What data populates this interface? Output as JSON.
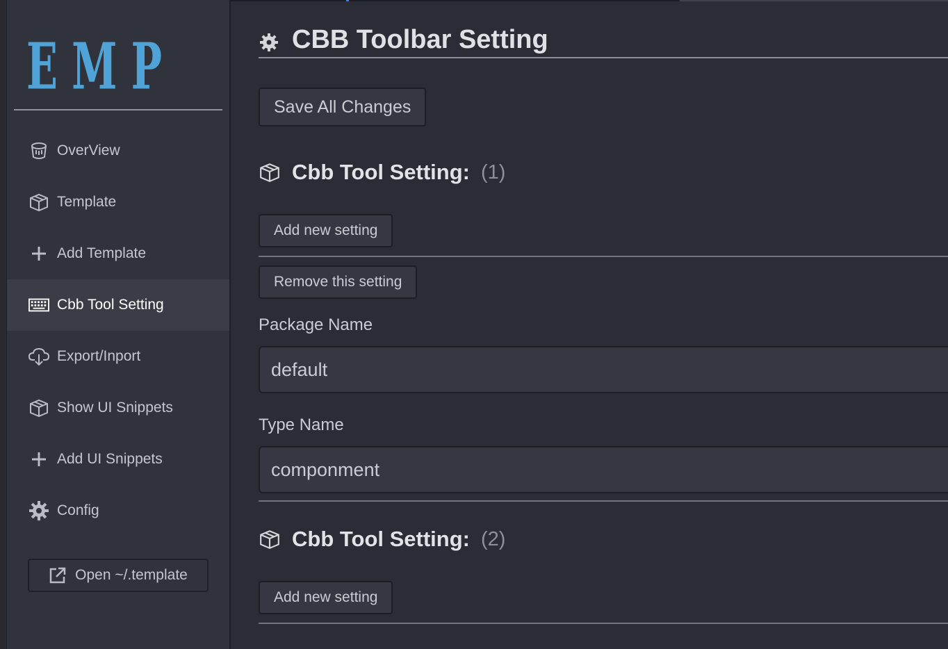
{
  "logo": {
    "text": "EMP",
    "color": "#4fa3d6"
  },
  "sidebar": {
    "items": [
      {
        "label": "OverView",
        "icon": "bucket-icon",
        "active": false
      },
      {
        "label": "Template",
        "icon": "box-icon",
        "active": false
      },
      {
        "label": "Add Template",
        "icon": "plus-icon",
        "active": false
      },
      {
        "label": "Cbb Tool Setting",
        "icon": "keyboard-icon",
        "active": true
      },
      {
        "label": "Export/Inport",
        "icon": "cloud-download-icon",
        "active": false
      },
      {
        "label": "Show UI Snippets",
        "icon": "box-icon",
        "active": false
      },
      {
        "label": "Add UI Snippets",
        "icon": "plus-icon",
        "active": false
      },
      {
        "label": "Config",
        "icon": "gear-icon",
        "active": false
      }
    ],
    "open_button": "Open ~/.template"
  },
  "main": {
    "title": "CBB Toolbar Setting",
    "save_button": "Save All Changes",
    "sections": [
      {
        "title": "Cbb Tool Setting:",
        "count": "(1)",
        "add_button": "Add new setting",
        "remove_button": "Remove this setting",
        "fields": [
          {
            "label": "Package Name",
            "value": "default"
          },
          {
            "label": "Type Name",
            "value": "componment"
          }
        ]
      },
      {
        "title": "Cbb Tool Setting:",
        "count": "(2)",
        "add_button": "Add new setting"
      }
    ]
  }
}
